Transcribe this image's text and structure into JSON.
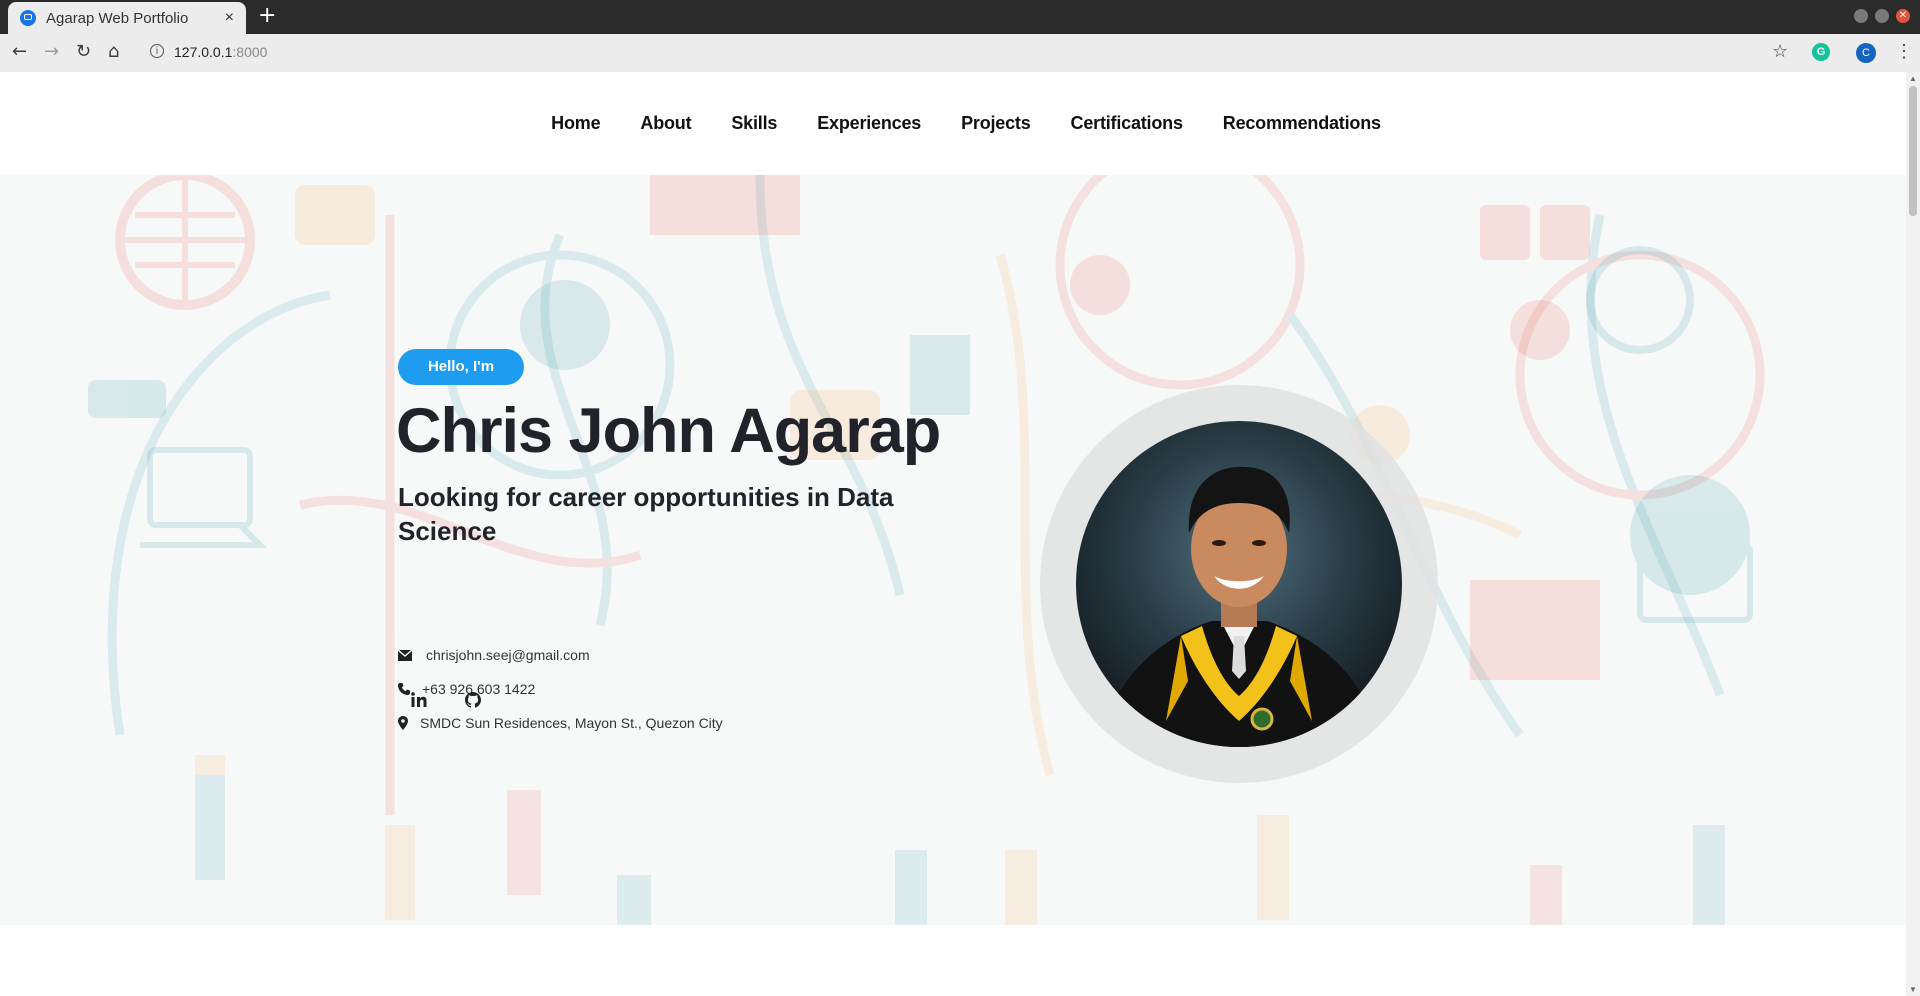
{
  "browser": {
    "tab_title": "Agarap Web Portfolio",
    "tab_close": "×",
    "new_tab": "+",
    "url_host": "127.0.0.1",
    "url_port": ":8000",
    "profile_initial": "C",
    "extension_initial": "G"
  },
  "nav": {
    "items": [
      "Home",
      "About",
      "Skills",
      "Experiences",
      "Projects",
      "Certifications",
      "Recommendations"
    ]
  },
  "hero": {
    "greeting": "Hello, I'm",
    "name": "Chris John Agarap",
    "tagline": "Looking for career opportunities in Data Science",
    "email": "chrisjohn.seej@gmail.com",
    "phone": "+63 926 603 1422",
    "address": "SMDC Sun Residences, Mayon St., Quezon City",
    "social": [
      "linkedin-icon",
      "github-icon"
    ]
  },
  "colors": {
    "accent": "#1e9cf0",
    "text_dark": "#22222a",
    "chrome_dark": "#2b2b2b"
  }
}
